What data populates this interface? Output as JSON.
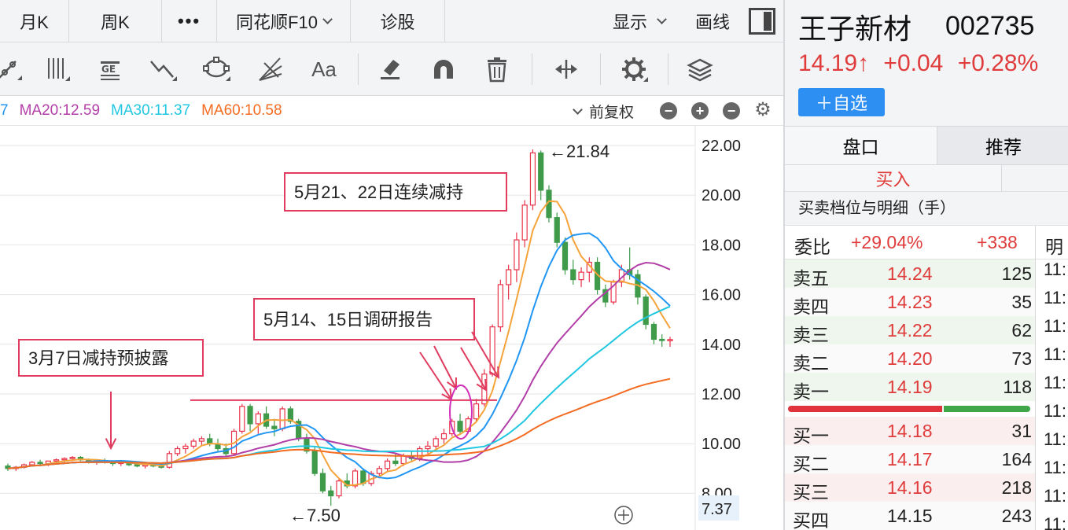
{
  "tabs": {
    "month": "月K",
    "week": "周K",
    "more": "•••",
    "f10": "同花顺F10",
    "diagnose": "诊股",
    "display": "显示",
    "draw": "画线"
  },
  "ma_bar": {
    "ma_cut": "7",
    "ma20": "MA20:12.59",
    "ma30": "MA30:11.37",
    "ma60": "MA60:10.58",
    "fuquan": "前复权",
    "colors": {
      "ma10": "#2196f3",
      "ma20": "#b23ea8",
      "ma30": "#21c7e0",
      "ma60": "#f36c21"
    }
  },
  "chart": {
    "price_labels": [
      "22.00",
      "20.00",
      "18.00",
      "16.00",
      "14.00",
      "12.00",
      "10.00",
      "8.00"
    ],
    "current_box": "7.37",
    "high_label": "←21.84",
    "low_label": "←7.50",
    "annotations": {
      "a1": "3月7日减持预披露",
      "a2": "5月14、15日调研报告",
      "a3": "5月21、22日连续减持"
    },
    "colors": {
      "up": "#e8334a",
      "down": "#3f9b4a",
      "annotation": "#e03c5f"
    }
  },
  "chart_data": {
    "type": "candlestick",
    "title": "",
    "y_ticks": [
      22,
      20,
      18,
      16,
      14,
      12,
      10,
      8
    ],
    "ylim": [
      7.2,
      22.4
    ],
    "high": 21.84,
    "low": 7.5,
    "series": [
      {
        "name": "MA20",
        "last": 12.59
      },
      {
        "name": "MA30",
        "last": 11.37
      },
      {
        "name": "MA60",
        "last": 10.58
      }
    ],
    "ohlc": [
      [
        9.1,
        9.2,
        8.9,
        9.0
      ],
      [
        9.0,
        9.1,
        8.9,
        9.05
      ],
      [
        9.05,
        9.2,
        9.0,
        9.15
      ],
      [
        9.15,
        9.3,
        9.1,
        9.25
      ],
      [
        9.25,
        9.35,
        9.15,
        9.2
      ],
      [
        9.2,
        9.3,
        9.1,
        9.3
      ],
      [
        9.3,
        9.4,
        9.2,
        9.35
      ],
      [
        9.35,
        9.45,
        9.25,
        9.4
      ],
      [
        9.4,
        9.5,
        9.3,
        9.45
      ],
      [
        9.45,
        9.5,
        9.3,
        9.35
      ],
      [
        9.35,
        9.4,
        9.2,
        9.25
      ],
      [
        9.25,
        9.35,
        9.15,
        9.3
      ],
      [
        9.3,
        9.4,
        9.2,
        9.25
      ],
      [
        9.25,
        9.3,
        9.1,
        9.2
      ],
      [
        9.2,
        9.3,
        9.1,
        9.25
      ],
      [
        9.25,
        9.3,
        9.1,
        9.15
      ],
      [
        9.15,
        9.2,
        9.05,
        9.1
      ],
      [
        9.1,
        9.2,
        9.0,
        9.15
      ],
      [
        9.15,
        9.25,
        9.05,
        9.1
      ],
      [
        9.1,
        9.2,
        9.0,
        9.05
      ],
      [
        9.05,
        9.7,
        9.0,
        9.6
      ],
      [
        9.6,
        9.9,
        9.5,
        9.8
      ],
      [
        9.8,
        10.0,
        9.6,
        9.9
      ],
      [
        9.9,
        10.2,
        9.8,
        10.1
      ],
      [
        10.1,
        10.3,
        9.95,
        10.2
      ],
      [
        10.2,
        10.4,
        9.9,
        10.0
      ],
      [
        10.0,
        10.2,
        9.7,
        9.8
      ],
      [
        9.8,
        10.0,
        9.5,
        9.6
      ],
      [
        9.6,
        10.6,
        9.5,
        10.5
      ],
      [
        10.5,
        11.6,
        10.4,
        11.5
      ],
      [
        11.5,
        11.6,
        10.5,
        10.8
      ],
      [
        10.8,
        11.3,
        10.4,
        11.2
      ],
      [
        11.2,
        11.5,
        10.6,
        10.7
      ],
      [
        10.7,
        11.0,
        10.3,
        10.6
      ],
      [
        10.6,
        11.5,
        10.5,
        11.4
      ],
      [
        11.4,
        11.5,
        10.8,
        10.9
      ],
      [
        10.9,
        11.0,
        10.1,
        10.2
      ],
      [
        10.2,
        10.4,
        9.6,
        9.7
      ],
      [
        9.7,
        9.9,
        8.7,
        8.8
      ],
      [
        8.8,
        9.0,
        8.0,
        8.1
      ],
      [
        8.1,
        8.3,
        7.5,
        7.9
      ],
      [
        7.9,
        8.6,
        7.8,
        8.5
      ],
      [
        8.5,
        8.8,
        8.2,
        8.3
      ],
      [
        8.3,
        9.0,
        8.2,
        8.9
      ],
      [
        8.9,
        9.0,
        8.3,
        8.4
      ],
      [
        8.4,
        8.9,
        8.3,
        8.8
      ],
      [
        8.8,
        9.1,
        8.6,
        9.0
      ],
      [
        9.0,
        9.4,
        8.9,
        9.3
      ],
      [
        9.3,
        9.6,
        9.1,
        9.2
      ],
      [
        9.2,
        9.6,
        9.1,
        9.5
      ],
      [
        9.5,
        9.7,
        9.3,
        9.4
      ],
      [
        9.4,
        9.9,
        9.3,
        9.8
      ],
      [
        9.8,
        10.1,
        9.6,
        9.9
      ],
      [
        9.9,
        10.3,
        9.8,
        10.2
      ],
      [
        10.2,
        10.6,
        10.0,
        10.4
      ],
      [
        10.4,
        11.0,
        10.3,
        10.9
      ],
      [
        10.9,
        11.2,
        10.4,
        10.5
      ],
      [
        10.5,
        11.1,
        10.4,
        11.0
      ],
      [
        11.0,
        11.8,
        10.9,
        11.6
      ],
      [
        11.6,
        13.0,
        11.5,
        12.8
      ],
      [
        12.8,
        14.8,
        12.7,
        14.7
      ],
      [
        14.7,
        16.6,
        14.5,
        16.4
      ],
      [
        16.4,
        17.2,
        15.8,
        17.0
      ],
      [
        17.0,
        18.5,
        16.5,
        18.2
      ],
      [
        18.2,
        19.8,
        17.9,
        19.6
      ],
      [
        19.6,
        21.84,
        19.4,
        21.7
      ],
      [
        21.7,
        21.8,
        19.8,
        20.2
      ],
      [
        20.2,
        20.4,
        18.9,
        19.1
      ],
      [
        19.1,
        19.3,
        17.9,
        18.1
      ],
      [
        18.1,
        18.3,
        16.8,
        17.0
      ],
      [
        17.0,
        17.4,
        16.4,
        16.6
      ],
      [
        16.6,
        17.1,
        16.3,
        16.9
      ],
      [
        16.9,
        17.5,
        16.5,
        17.3
      ],
      [
        17.3,
        17.5,
        16.0,
        16.2
      ],
      [
        16.2,
        16.4,
        15.5,
        15.7
      ],
      [
        15.7,
        16.6,
        15.6,
        16.5
      ],
      [
        16.5,
        17.2,
        16.3,
        17.0
      ],
      [
        17.0,
        17.9,
        16.6,
        16.8
      ],
      [
        16.8,
        17.0,
        15.6,
        15.9
      ],
      [
        15.9,
        16.0,
        14.6,
        14.8
      ],
      [
        14.8,
        14.9,
        14.0,
        14.2
      ],
      [
        14.2,
        14.4,
        13.9,
        14.15
      ],
      [
        14.15,
        14.3,
        13.9,
        14.19
      ]
    ]
  },
  "quote": {
    "name": "王子新材",
    "code": "002735",
    "price": "14.19↑",
    "change": "+0.04",
    "change_pct": "+0.28%",
    "watch": "＋自选",
    "tab_pankou": "盘口",
    "tab_tuijian": "推荐",
    "buy_tab": "买入",
    "detail_title": "买卖档位与明细（手）",
    "webi_label": "委比",
    "webi_pct": "+29.04%",
    "webi_diff": "+338",
    "ming": "明",
    "up_color": "#e03c3c",
    "down_color": "#3f9b4a"
  },
  "orderbook": {
    "sells": [
      {
        "label": "卖五",
        "price": "14.24",
        "vol": "125"
      },
      {
        "label": "卖四",
        "price": "14.23",
        "vol": "35"
      },
      {
        "label": "卖三",
        "price": "14.22",
        "vol": "62"
      },
      {
        "label": "卖二",
        "price": "14.20",
        "vol": "73"
      },
      {
        "label": "卖一",
        "price": "14.19",
        "vol": "118"
      }
    ],
    "buys": [
      {
        "label": "买一",
        "price": "14.18",
        "vol": "31"
      },
      {
        "label": "买二",
        "price": "14.17",
        "vol": "164"
      },
      {
        "label": "买三",
        "price": "14.16",
        "vol": "218"
      },
      {
        "label": "买四",
        "price": "14.15",
        "vol": "243"
      }
    ],
    "ticks": [
      "11:",
      "11:",
      "11:",
      "11:",
      "11:",
      "11:",
      "11:",
      "11:",
      "11:",
      "11:"
    ]
  }
}
